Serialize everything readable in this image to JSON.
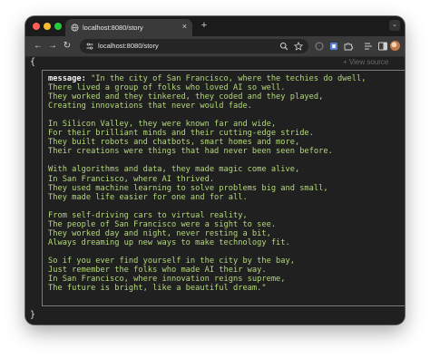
{
  "window": {
    "tab_title": "localhost:8080/story",
    "tab_close": "×",
    "new_tab": "+",
    "address": "localhost:8080/story"
  },
  "toolbar": {
    "back": "←",
    "forward": "→",
    "reload": "↻"
  },
  "page": {
    "open_brace": "{",
    "close_brace": "}",
    "view_source": "+ View source",
    "key": "message:",
    "value": " \"In the city of San Francisco, where the techies do dwell,\nThere lived a group of folks who loved AI so well.\nThey worked and they tinkered, they coded and they played,\nCreating innovations that never would fade.\n\nIn Silicon Valley, they were known far and wide,\nFor their brilliant minds and their cutting-edge stride.\nThey built robots and chatbots, smart homes and more,\nTheir creations were things that had never been seen before.\n\nWith algorithms and data, they made magic come alive,\nIn San Francisco, where AI thrived.\nThey used machine learning to solve problems big and small,\nThey made life easier for one and for all.\n\nFrom self-driving cars to virtual reality,\nThe people of San Francisco were a sight to see.\nThey worked day and night, never resting a bit,\nAlways dreaming up new ways to make technology fit.\n\nSo if you ever find yourself in the city by the bay,\nJust remember the folks who made AI their way.\nIn San Francisco, where innovation reigns supreme,\nThe future is bright, like a beautiful dream.\""
  },
  "colors": {
    "string_value": "#b4d87a",
    "key": "#f2f2f2",
    "background": "#202020"
  }
}
